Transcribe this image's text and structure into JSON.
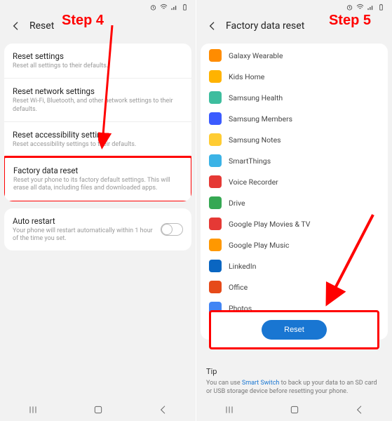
{
  "annotations": {
    "step4": "Step 4",
    "step5": "Step 5"
  },
  "statusbar_icons": [
    "alarm",
    "wifi",
    "signal",
    "battery"
  ],
  "left": {
    "title": "Reset",
    "items": [
      {
        "title": "Reset settings",
        "sub": "Reset all settings to their defaults."
      },
      {
        "title": "Reset network settings",
        "sub": "Reset Wi-Fi, Bluetooth, and other network settings to their defaults."
      },
      {
        "title": "Reset accessibility settings",
        "sub": "Reset accessibility settings to their defaults."
      },
      {
        "title": "Factory data reset",
        "sub": "Reset your phone to its factory default settings. This will erase all data, including files and downloaded apps."
      }
    ],
    "auto": {
      "title": "Auto restart",
      "sub": "Your phone will restart automatically within 1 hour of the time you set."
    }
  },
  "right": {
    "title": "Factory data reset",
    "apps": [
      {
        "name": "Galaxy Wearable",
        "color": "#ff8c00"
      },
      {
        "name": "Kids Home",
        "color": "#ffb300"
      },
      {
        "name": "Samsung Health",
        "color": "#3dbd9e"
      },
      {
        "name": "Samsung Members",
        "color": "#3b5bff"
      },
      {
        "name": "Samsung Notes",
        "color": "#ffcc33"
      },
      {
        "name": "SmartThings",
        "color": "#3bb3e6"
      },
      {
        "name": "Voice Recorder",
        "color": "#e53935"
      },
      {
        "name": "Drive",
        "color": "#36a853"
      },
      {
        "name": "Google Play Movies & TV",
        "color": "#e53935"
      },
      {
        "name": "Google Play Music",
        "color": "#ff9800"
      },
      {
        "name": "LinkedIn",
        "color": "#0a66c2"
      },
      {
        "name": "Office",
        "color": "#e64a19"
      },
      {
        "name": "Photos",
        "color": "#4285f4"
      }
    ],
    "reset_label": "Reset",
    "tip_title": "Tip",
    "tip_prefix": "You can use ",
    "tip_link": "Smart Switch",
    "tip_suffix": " to back up your data to an SD card or USB storage device before resetting your phone."
  }
}
